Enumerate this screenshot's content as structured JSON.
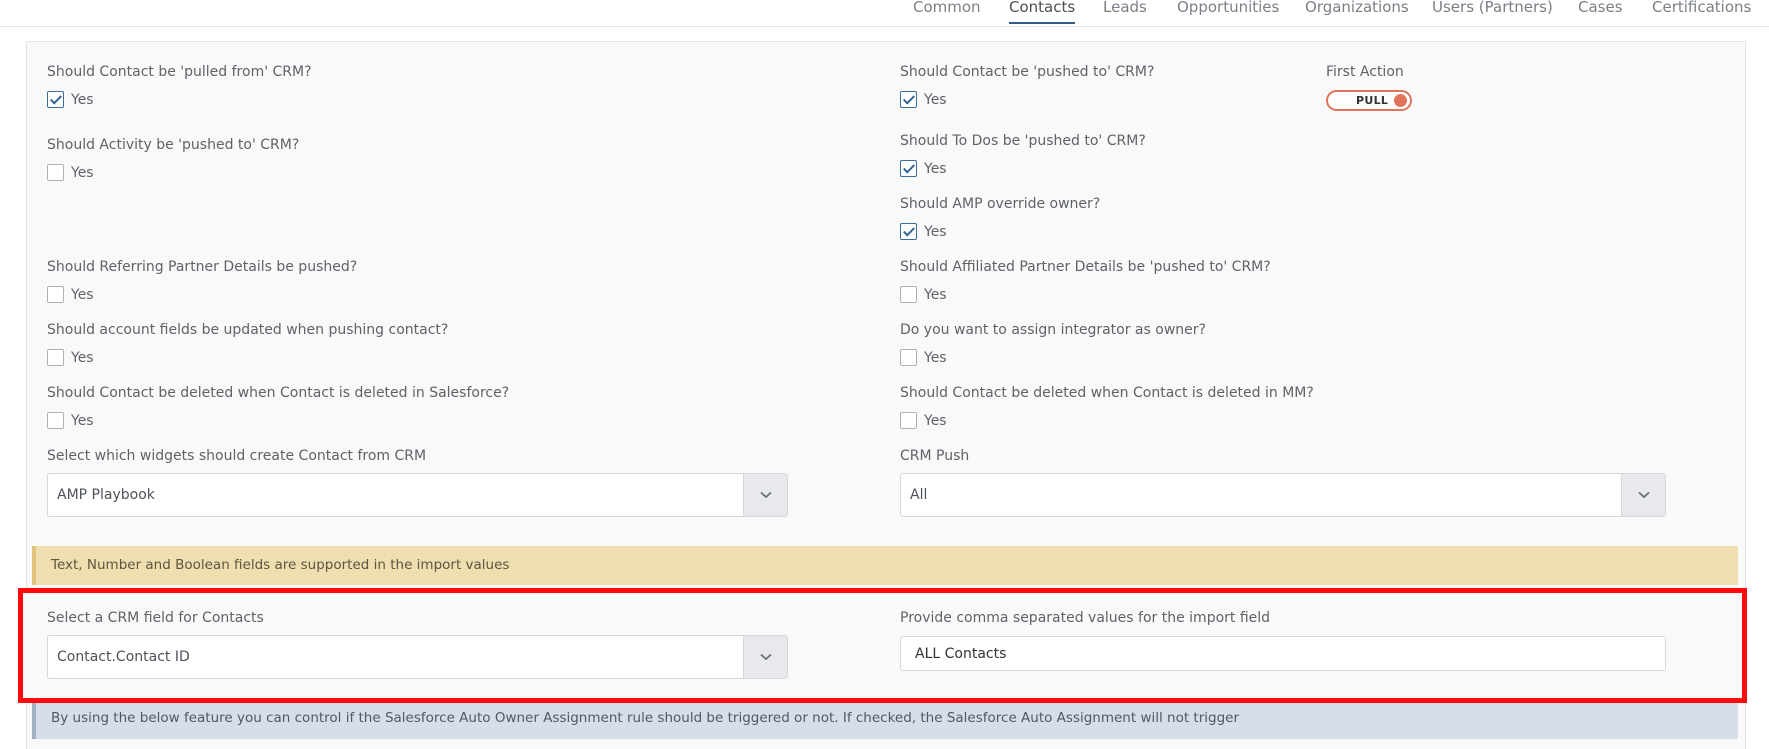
{
  "tabs": [
    {
      "label": "Common",
      "active": false
    },
    {
      "label": "Contacts",
      "active": true
    },
    {
      "label": "Leads",
      "active": false
    },
    {
      "label": "Opportunities",
      "active": false
    },
    {
      "label": "Organizations",
      "active": false
    },
    {
      "label": "Users (Partners)",
      "active": false
    },
    {
      "label": "Cases",
      "active": false
    },
    {
      "label": "Certifications",
      "active": false
    }
  ],
  "questions": {
    "pulled_from": {
      "label": "Should Contact be 'pulled from' CRM?",
      "option": "Yes",
      "checked": true
    },
    "pushed_to": {
      "label": "Should Contact be 'pushed to' CRM?",
      "option": "Yes",
      "checked": true
    },
    "activity_pushed": {
      "label": "Should Activity be 'pushed to' CRM?",
      "option": "Yes",
      "checked": false
    },
    "todos_pushed": {
      "label": "Should To Dos be 'pushed to' CRM?",
      "option": "Yes",
      "checked": true
    },
    "amp_override": {
      "label": "Should AMP override owner?",
      "option": "Yes",
      "checked": true
    },
    "referring_partner": {
      "label": "Should Referring Partner Details be pushed?",
      "option": "Yes",
      "checked": false
    },
    "affiliated_partner": {
      "label": "Should Affiliated Partner Details be 'pushed to' CRM?",
      "option": "Yes",
      "checked": false
    },
    "account_fields": {
      "label": "Should account fields be updated when pushing contact?",
      "option": "Yes",
      "checked": false
    },
    "integrator_owner": {
      "label": "Do you want to assign integrator as owner?",
      "option": "Yes",
      "checked": false
    },
    "deleted_salesforce": {
      "label": "Should Contact be deleted when Contact is deleted in Salesforce?",
      "option": "Yes",
      "checked": false
    },
    "deleted_mm": {
      "label": "Should Contact be deleted when Contact is deleted in MM?",
      "option": "Yes",
      "checked": false
    }
  },
  "first_action": {
    "label": "First Action",
    "value": "PULL",
    "accent": "#e1735a"
  },
  "widgets_select": {
    "label": "Select which widgets should create Contact from CRM",
    "value": "AMP Playbook"
  },
  "crm_push_select": {
    "label": "CRM Push",
    "value": "All"
  },
  "import_notice": "Text, Number and Boolean fields are supported in the import values",
  "crm_field_select": {
    "label": "Select a CRM field for Contacts",
    "value": "Contact.Contact ID"
  },
  "import_values": {
    "label": "Provide comma separated values for the import field",
    "value": "ALL Contacts"
  },
  "auto_assign_notice": "By using the below feature you can control if the Salesforce Auto Owner Assignment rule should be triggered or not. If checked, the Salesforce Auto Assignment will not trigger",
  "colors": {
    "highlight": "#ff0a0a",
    "tab_active_underline": "#2f5d87",
    "warn_bg": "#efdfb0",
    "info_bg": "#d8dee7"
  }
}
